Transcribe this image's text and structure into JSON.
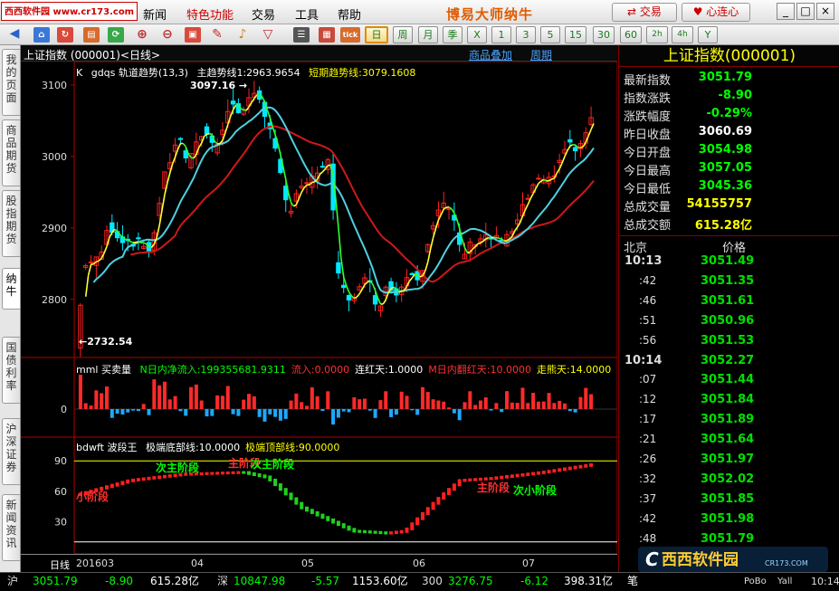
{
  "app": {
    "title": "博易大师纳牛",
    "site_badge": "西西软件园 www.cr173.com",
    "menu": [
      "新闻",
      "特色功能",
      "交易",
      "工具",
      "帮助"
    ],
    "trade_button": "交易",
    "connect_button": "心连心",
    "window_buttons": [
      "_",
      "□",
      "×"
    ]
  },
  "toolbar": {
    "period_buttons": [
      "日",
      "周",
      "月",
      "季",
      "X",
      "1",
      "3",
      "5",
      "15",
      "30",
      "60",
      "2h",
      "4h",
      "Y"
    ],
    "active_period": "日"
  },
  "sidebar": {
    "tabs": [
      "我的页面",
      "商品期货",
      "股指期货",
      "纳牛",
      "国债利率",
      "沪深证券",
      "新闻资讯"
    ],
    "active": "纳牛"
  },
  "chart": {
    "header_title": "上证指数 (000001)<日线>",
    "header_links": [
      "商品叠加",
      "周期"
    ],
    "main_indicator": {
      "prefix": "K",
      "name": "gdqs 轨道趋势(13,3)",
      "line1": "主趋势线1:2963.9654",
      "line2": "短期趋势线:3079.1608"
    },
    "annotations": {
      "high": "3097.16",
      "low": "2732.54"
    },
    "y_labels": [
      "3100",
      "3000",
      "2900",
      "2800"
    ],
    "sub1": {
      "name": "mml 买卖量",
      "items": [
        {
          "text": "N日内净流入:199355681.9311",
          "color": "#00ff00"
        },
        {
          "text": "流入:0.0000",
          "color": "#ff3030"
        },
        {
          "text": "连红天:1.0000",
          "color": "#ffffff"
        },
        {
          "text": "M日内翻红天:10.0000",
          "color": "#ff3030"
        },
        {
          "text": "走熊天:14.0000",
          "color": "#ffff00"
        }
      ],
      "y_label": "0"
    },
    "sub2": {
      "name": "bdwft 波段王",
      "items": [
        {
          "text": "极端底部线:10.0000",
          "color": "#ffffff"
        },
        {
          "text": "极端顶部线:90.0000",
          "color": "#ffff00"
        }
      ],
      "y_labels": [
        "90",
        "60",
        "30"
      ],
      "stage_labels": [
        {
          "text": "小阶段",
          "color": "#ff3030"
        },
        {
          "text": "次主阶段",
          "color": "#00ff00"
        },
        {
          "text": "主阶段",
          "color": "#ff3030"
        },
        {
          "text": "次主阶段",
          "color": "#00ff00"
        },
        {
          "text": "主阶段",
          "color": "#ff3030"
        },
        {
          "text": "次小阶段",
          "color": "#00ff00"
        }
      ]
    },
    "x_axis": {
      "period": "日线",
      "labels": [
        "201603",
        "04",
        "05",
        "06",
        "07"
      ]
    }
  },
  "chart_data": {
    "type": "line",
    "title": "上证指数 (000001) 日线",
    "x": [
      "201603",
      "04",
      "05",
      "06",
      "07"
    ],
    "ylim": [
      2720,
      3110
    ],
    "series": [
      {
        "name": "主趋势线1",
        "last": 2963.9654
      },
      {
        "name": "短期趋势线",
        "last": 3079.1608
      }
    ],
    "high": 3097.16,
    "low": 2732.54,
    "indicator_ylim": [
      10,
      90
    ]
  },
  "quote": {
    "title": "上证指数(000001)",
    "rows": [
      {
        "label": "最新指数",
        "value": "3051.79",
        "color": "#00ff00"
      },
      {
        "label": "指数涨跌",
        "value": "-8.90",
        "color": "#00ff00"
      },
      {
        "label": "涨跌幅度",
        "value": "-0.29%",
        "color": "#00ff00"
      },
      {
        "label": "昨日收盘",
        "value": "3060.69",
        "color": "#ffffff"
      },
      {
        "label": "今日开盘",
        "value": "3054.98",
        "color": "#00ff00"
      },
      {
        "label": "今日最高",
        "value": "3057.05",
        "color": "#00ff00"
      },
      {
        "label": "今日最低",
        "value": "3045.36",
        "color": "#00ff00"
      },
      {
        "label": "总成交量",
        "value": "54155757",
        "color": "#ffff00"
      },
      {
        "label": "总成交额",
        "value": "615.28亿",
        "color": "#ffff00"
      }
    ],
    "tick_header": {
      "left": "北京",
      "right": "价格"
    },
    "ticks": [
      {
        "time": "10:13",
        "price": "3051.49"
      },
      {
        "time": ":42",
        "price": "3051.35"
      },
      {
        "time": ":46",
        "price": "3051.61"
      },
      {
        "time": ":51",
        "price": "3050.96"
      },
      {
        "time": ":56",
        "price": "3051.53"
      },
      {
        "time": "10:14",
        "price": "3052.27"
      },
      {
        "time": ":07",
        "price": "3051.44"
      },
      {
        "time": ":12",
        "price": "3051.84"
      },
      {
        "time": ":17",
        "price": "3051.89"
      },
      {
        "time": ":21",
        "price": "3051.64"
      },
      {
        "time": ":26",
        "price": "3051.97"
      },
      {
        "time": ":32",
        "price": "3052.02"
      },
      {
        "time": ":37",
        "price": "3051.85"
      },
      {
        "time": ":42",
        "price": "3051.98"
      },
      {
        "time": ":48",
        "price": "3051.79"
      }
    ],
    "watermark": "西西软件园",
    "watermark_sub": "CR173.COM"
  },
  "status": {
    "items": [
      {
        "label": "沪",
        "price": "3051.79",
        "change": "-8.90",
        "amount": "615.28亿"
      },
      {
        "label": "深",
        "price": "10847.98",
        "change": "-5.57",
        "amount": "1153.60亿"
      },
      {
        "label": "300",
        "price": "3276.75",
        "change": "-6.12",
        "amount": "398.31亿"
      }
    ],
    "brand": "PoBo",
    "user": "Yall",
    "time": "10:14",
    "bottom_tab": "笔"
  }
}
